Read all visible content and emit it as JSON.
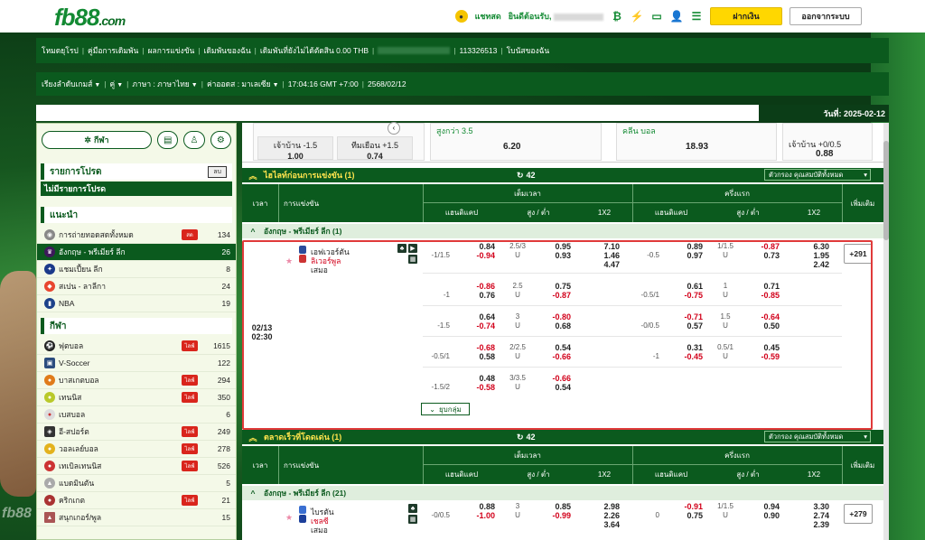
{
  "header": {
    "logo_main": "fb88",
    "logo_suffix": ".com",
    "chat_label": "แชทสด",
    "welcome": "ยินดีต้อนรับ,",
    "deposit": "ฝากเงิน",
    "logout": "ออกจากระบบ"
  },
  "info1": {
    "items": [
      "โหมดยุโรป",
      "คู่มือการเดิมพัน",
      "ผลการแข่งขัน",
      "เดิมพันของฉัน",
      "เดิมพันที่ยังไม่ได้ตัดสิน 0.00 THB",
      "113326513",
      "โบนัสของฉัน"
    ]
  },
  "info2": {
    "items": [
      "เรียงลำดับเกมส์",
      "คู่",
      "ภาษา : ภาษาไทย",
      "ค่าออดส : มาเลเซีย",
      "17:04:16 GMT +7:00",
      "2568/02/12"
    ]
  },
  "date_label": "วันที่: 2025-02-12",
  "sidebar": {
    "sport_button": "กีฬา",
    "my_list_title": "รายการโปรด",
    "hide_label": "ลบ",
    "no_list": "ไม่มีรายการโปรด",
    "recommend_title": "แนะนำ",
    "recommend": [
      {
        "label": "การถ่ายทอดสดทั้งหมด",
        "live": "สด",
        "count": "134"
      },
      {
        "label": "อังกฤษ - พรีเมียร์ ลีก",
        "count": "26"
      },
      {
        "label": "แชมเปี้ยน ลีก",
        "count": "8"
      },
      {
        "label": "สเปน - ลาลีกา",
        "count": "24"
      },
      {
        "label": "NBA",
        "count": "19"
      }
    ],
    "sports_title": "กีฬา",
    "sports": [
      {
        "label": "ฟุตบอล",
        "live": "ไลฟ์",
        "count": "1615"
      },
      {
        "label": "V-Soccer",
        "count": "122"
      },
      {
        "label": "บาสเกตบอล",
        "live": "ไลฟ์",
        "count": "294"
      },
      {
        "label": "เทนนิส",
        "live": "ไลฟ์",
        "count": "350"
      },
      {
        "label": "เบสบอล",
        "count": "6"
      },
      {
        "label": "อี-สปอร์ต",
        "live": "ไลฟ์",
        "count": "249"
      },
      {
        "label": "วอลเลย์บอล",
        "live": "ไลฟ์",
        "count": "278"
      },
      {
        "label": "เทเบิลเทนนิส",
        "live": "ไลฟ์",
        "count": "526"
      },
      {
        "label": "แบดมินตัน",
        "count": "5"
      },
      {
        "label": "คริกเกต",
        "live": "ไลฟ์",
        "count": "21"
      },
      {
        "label": "สนุกเกอร์/พูล",
        "count": "15"
      }
    ]
  },
  "highlights": {
    "c1_home": "เจ้าบ้าน -1.5",
    "c1_home_odds": "1.00",
    "c1_away": "ทีมเยือน +1.5",
    "c1_away_odds": "0.74",
    "c2_label": "สูงกว่า 3.5",
    "c2_odds": "6.20",
    "c3_label": "คลีน บอล",
    "c3_odds": "18.93",
    "c4_label": "เจ้าบ้าน +0/0.5",
    "c4_odds": "0.88"
  },
  "section1": {
    "title": "ไฮไลท์ก่อนการแข่งขัน (1)",
    "refresh": "42",
    "filter": "ตัวกรอง คุณสมบัติทั้งหมด"
  },
  "table_head": {
    "time": "เวลา",
    "match": "การแข่งขัน",
    "full": "เต็มเวลา",
    "half": "ครึ่งแรก",
    "handicap": "แฮนดิแคป",
    "ou": "สูง / ต่ำ",
    "x12": "1X2",
    "more": "เพิ่มเติม"
  },
  "league1": "อังกฤษ - พรีเมียร์ ลีก (1)",
  "match1": {
    "date": "02/13",
    "time": "02:30",
    "home": "เอฟเวอร์ตัน",
    "away": "ลิเวอร์พูล",
    "draw": "เสมอ",
    "more": "+291",
    "collapse": "ยุบกลุ่ม",
    "rows": [
      {
        "ft_hdp": "-1/1.5",
        "ft_h": "0.84",
        "ft_a": "-0.94",
        "ft_ou": "2.5/3",
        "ft_u": "U",
        "ft_o1": "0.95",
        "ft_o2": "0.93",
        "x1": "7.10",
        "x2": "1.46",
        "x3": "4.47",
        "ht_hdp": "-0.5",
        "ht_h": "0.89",
        "ht_a": "0.97",
        "ht_ou": "1/1.5",
        "ht_u": "U",
        "ht_o1": "-0.87",
        "ht_o2": "0.73",
        "hx1": "6.30",
        "hx2": "1.95",
        "hx3": "2.42"
      },
      {
        "ft_hdp": "-1",
        "ft_h": "-0.86",
        "ft_a": "0.76",
        "ft_ou": "2.5",
        "ft_u": "U",
        "ft_o1": "0.75",
        "ft_o2": "-0.87",
        "ht_hdp": "-0.5/1",
        "ht_h": "0.61",
        "ht_a": "-0.75",
        "ht_ou": "1",
        "ht_u": "U",
        "ht_o1": "0.71",
        "ht_o2": "-0.85"
      },
      {
        "ft_hdp": "-1.5",
        "ft_h": "0.64",
        "ft_a": "-0.74",
        "ft_ou": "3",
        "ft_u": "U",
        "ft_o1": "-0.80",
        "ft_o2": "0.68",
        "ht_hdp": "-0/0.5",
        "ht_h": "-0.71",
        "ht_a": "0.57",
        "ht_ou": "1.5",
        "ht_u": "U",
        "ht_o1": "-0.64",
        "ht_o2": "0.50"
      },
      {
        "ft_hdp": "-0.5/1",
        "ft_h": "-0.68",
        "ft_a": "0.58",
        "ft_ou": "2/2.5",
        "ft_u": "U",
        "ft_o1": "0.54",
        "ft_o2": "-0.66",
        "ht_hdp": "-1",
        "ht_h": "0.31",
        "ht_a": "-0.45",
        "ht_ou": "0.5/1",
        "ht_u": "U",
        "ht_o1": "0.45",
        "ht_o2": "-0.59"
      },
      {
        "ft_hdp": "-1.5/2",
        "ft_h": "0.48",
        "ft_a": "-0.58",
        "ft_ou": "3/3.5",
        "ft_u": "U",
        "ft_o1": "-0.66",
        "ft_o2": "0.54"
      }
    ]
  },
  "section2": {
    "title": "ตลาดเร็วที่โดดเด่น (1)",
    "refresh": "42",
    "filter": "ตัวกรอง คุณสมบัติทั้งหมด"
  },
  "league2": "อังกฤษ - พรีเมียร์ ลีก (21)",
  "match2": {
    "home": "ไบรตัน",
    "away": "เชลซี",
    "draw": "เสมอ",
    "more": "+279",
    "ft_hdp": "-0/0.5",
    "ft_h": "0.88",
    "ft_a": "-1.00",
    "ft_ou": "3",
    "ft_u": "U",
    "ft_o1": "0.85",
    "ft_o2": "-0.99",
    "x1": "2.98",
    "x2": "2.26",
    "x3": "3.64",
    "ht_hdp": "0",
    "ht_h": "-0.91",
    "ht_a": "0.75",
    "ht_ou": "1/1.5",
    "ht_u": "U",
    "ht_o1": "0.94",
    "ht_o2": "0.90",
    "hx1": "3.30",
    "hx2": "2.74",
    "hx3": "2.39"
  },
  "colors": {
    "brand": "#0b5a1e",
    "accent": "#ffd700",
    "negative": "#d2001a"
  }
}
